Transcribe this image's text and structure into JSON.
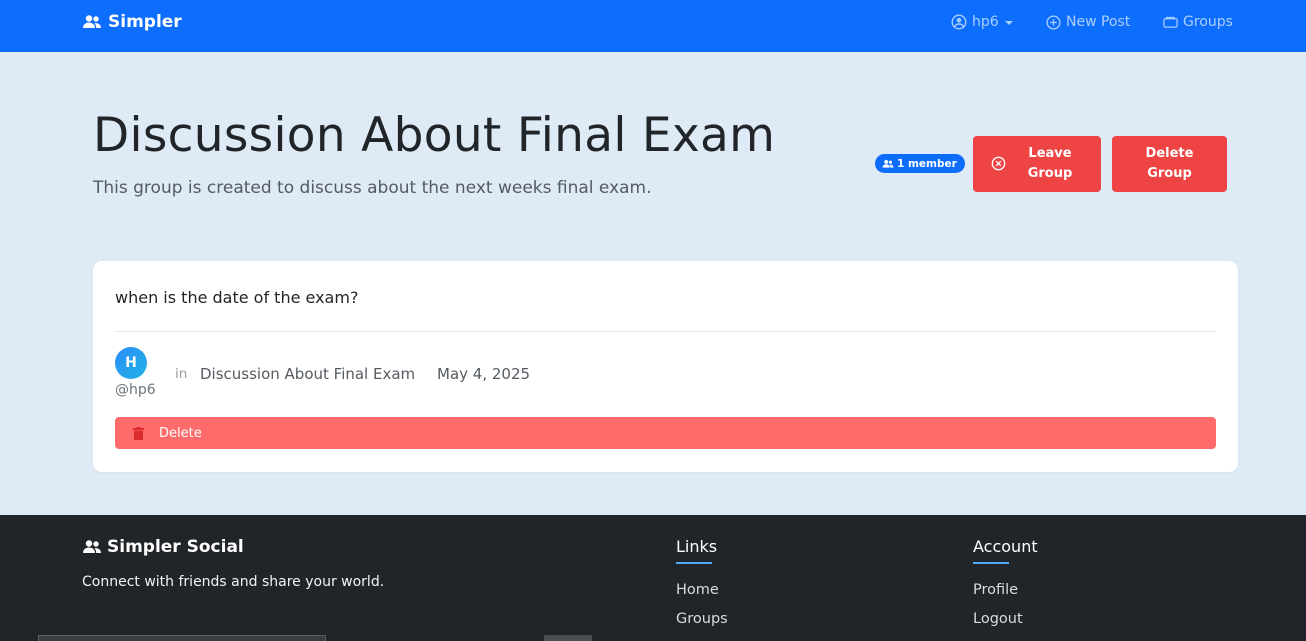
{
  "navbar": {
    "brand": "Simpler",
    "user_label": "hp6",
    "new_post_label": "New Post",
    "groups_label": "Groups"
  },
  "group": {
    "title": "Discussion About Final Exam",
    "description": "This group is created to discuss about the next weeks final exam.",
    "member_badge": "1 member",
    "leave_label": "Leave Group",
    "delete_label": "Delete Group"
  },
  "post": {
    "text": "when is the date of the exam?",
    "avatar_initial": "H",
    "username": "@hp6",
    "in_label": "in",
    "group_name": "Discussion About Final Exam",
    "date": "May 4, 2025",
    "delete_label": "Delete"
  },
  "footer": {
    "brand": "Simpler Social",
    "tagline": "Connect with friends and share your world.",
    "links_heading": "Links",
    "link_home": "Home",
    "link_groups": "Groups",
    "account_heading": "Account",
    "link_profile": "Profile",
    "link_logout": "Logout"
  },
  "colors": {
    "primary": "#0d6efd",
    "danger": "#ef4444",
    "danger_light": "#ff6b6b",
    "page_bg": "#deeaf6",
    "footer_bg": "#212529"
  },
  "icons": [
    "users-icon",
    "user-circle-icon",
    "plus-circle-icon",
    "folder-icon",
    "x-circle-icon",
    "trash-icon"
  ]
}
